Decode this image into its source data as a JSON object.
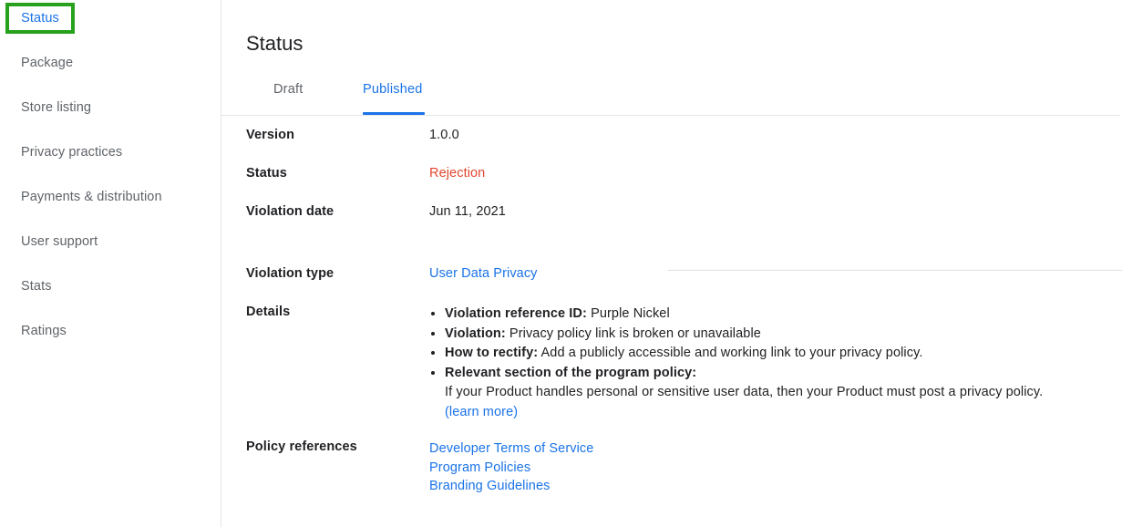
{
  "sidebar": {
    "items": [
      {
        "label": "Status",
        "active": true
      },
      {
        "label": "Package",
        "active": false
      },
      {
        "label": "Store listing",
        "active": false
      },
      {
        "label": "Privacy practices",
        "active": false
      },
      {
        "label": "Payments & distribution",
        "active": false
      },
      {
        "label": "User support",
        "active": false
      },
      {
        "label": "Stats",
        "active": false
      },
      {
        "label": "Ratings",
        "active": false
      }
    ]
  },
  "main": {
    "title": "Status",
    "tabs": [
      {
        "label": "Draft",
        "selected": false
      },
      {
        "label": "Published",
        "selected": true
      }
    ],
    "fields": {
      "version_label": "Version",
      "version_value": "1.0.0",
      "status_label": "Status",
      "status_value": "Rejection",
      "violation_date_label": "Violation date",
      "violation_date_value": "Jun 11, 2021",
      "violation_type_label": "Violation type",
      "violation_type_value": "User Data Privacy",
      "details_label": "Details",
      "policy_references_label": "Policy references"
    },
    "details_bullets": [
      {
        "term": "Violation reference ID:",
        "text": " Purple Nickel"
      },
      {
        "term": "Violation:",
        "text": " Privacy policy link is broken or unavailable"
      },
      {
        "term": "How to rectify:",
        "text": " Add a publicly accessible and working link to your privacy policy."
      },
      {
        "term": "Relevant section of the program policy:",
        "text": ""
      }
    ],
    "details_sub_paragraph": "If your Product handles personal or sensitive user data, then your Product must post a privacy policy.",
    "details_sub_link": "(learn more)",
    "policy_links": [
      "Developer Terms of Service",
      "Program Policies",
      "Branding Guidelines"
    ]
  },
  "colors": {
    "link": "#1a73e8",
    "rejection": "#e2462f",
    "highlight_box": "#27a01b",
    "text": "#202124",
    "muted": "#5f6368",
    "border": "#e4e6e8"
  }
}
